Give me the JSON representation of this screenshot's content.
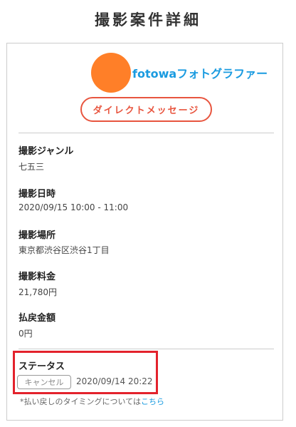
{
  "page": {
    "title": "撮影案件詳細"
  },
  "photographer": {
    "name": "fotowaフォトグラファー",
    "avatar_color": "#ff7f28"
  },
  "actions": {
    "message_button_label": "ダイレクトメッセージ"
  },
  "details": {
    "genre": {
      "label": "撮影ジャンル",
      "value": "七五三"
    },
    "datetime": {
      "label": "撮影日時",
      "value": "2020/09/15 10:00 - 11:00"
    },
    "location": {
      "label": "撮影場所",
      "value": "東京都渋谷区渋谷1丁目"
    },
    "fee": {
      "label": "撮影料金",
      "value": "21,780円"
    },
    "refund": {
      "label": "払戻金額",
      "value": "0円"
    }
  },
  "status": {
    "label": "ステータス",
    "badge": "キャンセル",
    "timestamp": "2020/09/14 20:22",
    "highlight_color": "#e3222c"
  },
  "note": {
    "text": "*払い戻しのタイミングについては",
    "link_text": "こちら"
  },
  "colors": {
    "accent_red": "#e8553f",
    "link_blue": "#1a9be0"
  }
}
